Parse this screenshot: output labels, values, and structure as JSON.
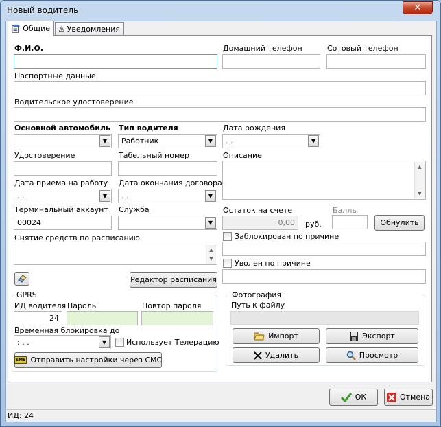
{
  "window": {
    "title": "Новый водитель",
    "close_glyph": "✕"
  },
  "tabs": [
    {
      "label": "Общие",
      "icon": "form-icon"
    },
    {
      "label": "Уведомления",
      "icon": "warning-icon"
    }
  ],
  "form": {
    "fio_label": "Ф.И.О.",
    "home_phone_label": "Домашний телефон",
    "cell_phone_label": "Сотовый телефон",
    "passport_label": "Паспортные данные",
    "license_label": "Водительское удостоверение",
    "main_car_label": "Основной автомобиль",
    "driver_type_label": "Тип водителя",
    "driver_type_value": "Работник",
    "birth_date_label": "Дата рождения",
    "birth_date_value": " . .",
    "id_card_label": "Удостоверение",
    "tab_number_label": "Табельный номер",
    "description_label": "Описание",
    "hire_date_label": "Дата приема на работу",
    "hire_date_value": " . .",
    "contract_end_label": "Дата окончания договора",
    "contract_end_value": " . .",
    "terminal_account_label": "Терминальный аккаунт",
    "terminal_account_value": "00024",
    "service_label": "Служба",
    "balance_label": "Остаток на счете",
    "balance_value": "0,00",
    "balance_unit": "руб.",
    "points_label": "Баллы",
    "reset_button": "Обнулить",
    "scheduled_withdrawal_label": "Снятие средств по расписанию",
    "blocked_label": "Заблокирован по причине",
    "fired_label": "Уволен по причине",
    "schedule_editor_button": "Редактор расписания"
  },
  "gprs": {
    "group_title": "GPRS",
    "driver_id_label": "ИД водителя",
    "driver_id_value": "24",
    "password_label": "Пароль",
    "repeat_password_label": "Повтор пароля",
    "temp_block_label": "Временная блокировка до",
    "temp_block_value": " :   . .",
    "telematics_label": "Использует Телерацию",
    "send_sms_button": "Отправить настройки через СМС",
    "sms_icon_text": "SMS"
  },
  "photo": {
    "group_title": "Фотография",
    "path_label": "Путь к файлу",
    "import_button": "Импорт",
    "export_button": "Экспорт",
    "delete_button": "Удалить",
    "view_button": "Просмотр"
  },
  "footer": {
    "ok_button": "ОК",
    "cancel_button": "Отмена",
    "status_text": "ИД: 24"
  },
  "colors": {
    "focus_border": "#5a9bd5",
    "password_bg": "#e3f5d6",
    "ok_green": "#3a9a2a",
    "cancel_red": "#c8302a"
  }
}
